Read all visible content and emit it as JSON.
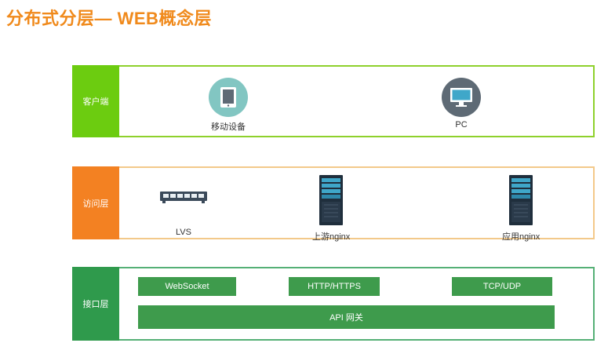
{
  "title": "分布式分层— WEB概念层",
  "layers": {
    "client": {
      "label": "客户端",
      "nodes": [
        {
          "label": "移动设备",
          "icon": "tablet-icon",
          "color": "#82c6c2"
        },
        {
          "label": "PC",
          "icon": "monitor-icon",
          "color": "#5e6a75"
        }
      ]
    },
    "access": {
      "label": "访问层",
      "nodes": [
        {
          "label": "LVS",
          "icon": "network-switch-icon"
        },
        {
          "label": "上游nginx",
          "icon": "server-rack-icon"
        },
        {
          "label": "应用nginx",
          "icon": "server-rack-icon"
        }
      ]
    },
    "api": {
      "label": "接口层",
      "items": [
        "WebSocket",
        "HTTP/HTTPS",
        "TCP/UDP"
      ],
      "gateway": "API 网关"
    }
  },
  "colors": {
    "title": "#f08a1c",
    "client_tag": "#6ccc10",
    "access_tag": "#f38122",
    "api_tag": "#2f9a4c",
    "api_pill": "#3e9b4c"
  }
}
